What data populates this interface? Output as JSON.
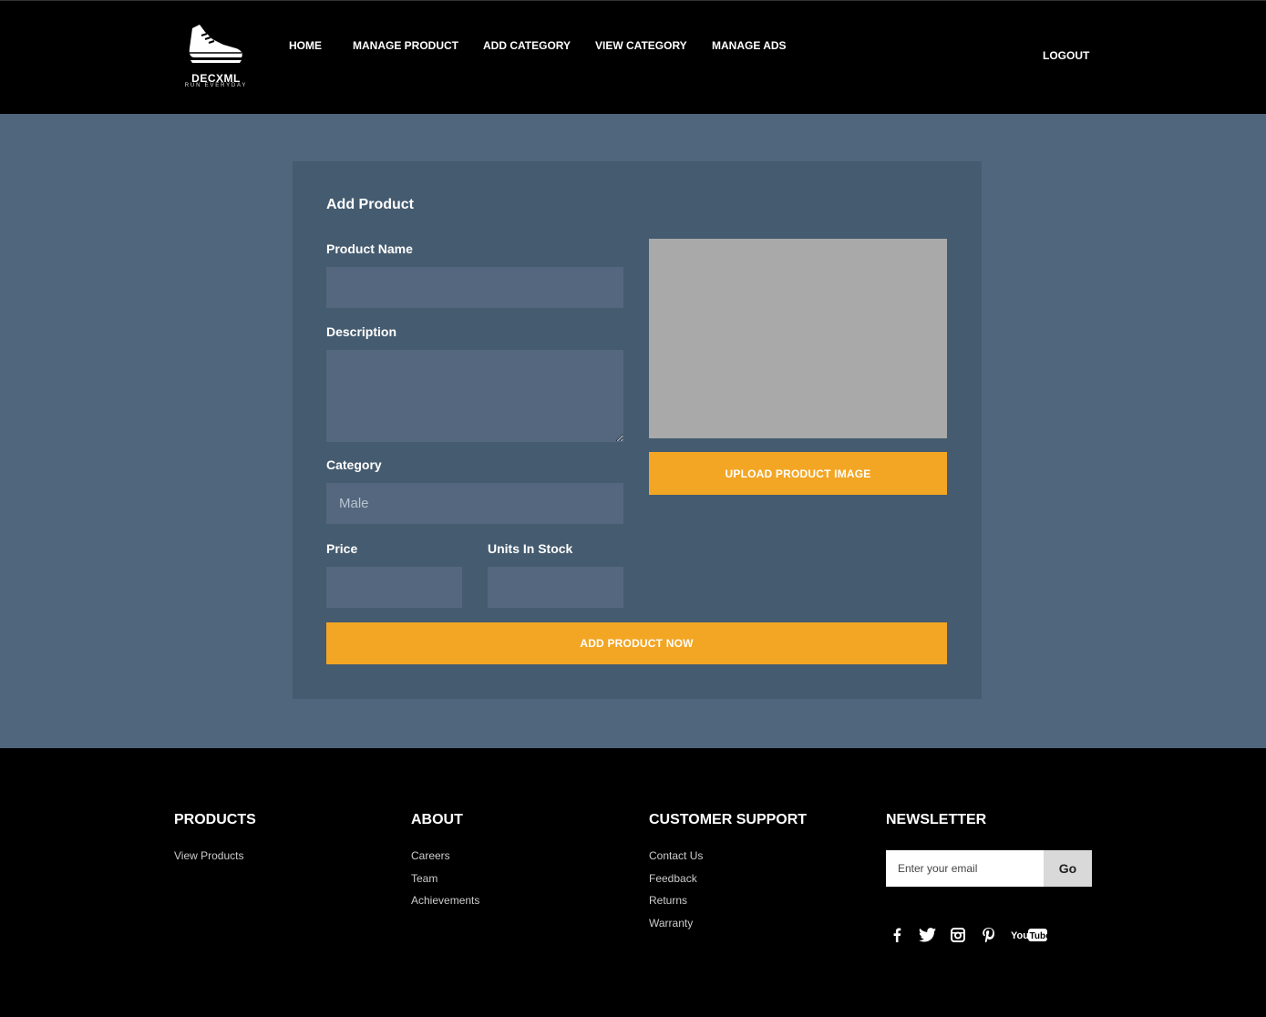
{
  "brand": {
    "name": "DECXML",
    "tagline": "RUN EVERYDAY"
  },
  "nav": {
    "items": [
      {
        "label": "HOME"
      },
      {
        "label": "MANAGE PRODUCT"
      },
      {
        "label": "ADD CATEGORY"
      },
      {
        "label": "VIEW CATEGORY"
      },
      {
        "label": "MANAGE ADS"
      }
    ],
    "logout": "LOGOUT"
  },
  "form": {
    "title": "Add Product",
    "product_name": {
      "label": "Product Name",
      "value": ""
    },
    "description": {
      "label": "Description",
      "value": ""
    },
    "category": {
      "label": "Category",
      "value": "Male"
    },
    "price": {
      "label": "Price",
      "value": ""
    },
    "units_in_stock": {
      "label": "Units In Stock",
      "value": ""
    },
    "upload_button": "UPLOAD PRODUCT IMAGE",
    "submit_button": "ADD PRODUCT NOW"
  },
  "footer": {
    "products": {
      "heading": "PRODUCTS",
      "links": [
        "View Products"
      ]
    },
    "about": {
      "heading": "ABOUT",
      "links": [
        "Careers",
        "Team",
        "Achievements"
      ]
    },
    "support": {
      "heading": "CUSTOMER SUPPORT",
      "links": [
        "Contact Us",
        "Feedback",
        "Returns",
        "Warranty"
      ]
    },
    "newsletter": {
      "heading": "NEWSLETTER",
      "placeholder": "Enter your email",
      "button": "Go"
    },
    "social_icons": [
      "facebook-icon",
      "twitter-icon",
      "instagram-icon",
      "pinterest-icon",
      "youtube-icon"
    ]
  },
  "colors": {
    "accent": "#f3a624",
    "page_bg": "#4f667c",
    "card_bg": "#455b6f",
    "field_bg": "#54677e",
    "header_bg": "#000000"
  }
}
